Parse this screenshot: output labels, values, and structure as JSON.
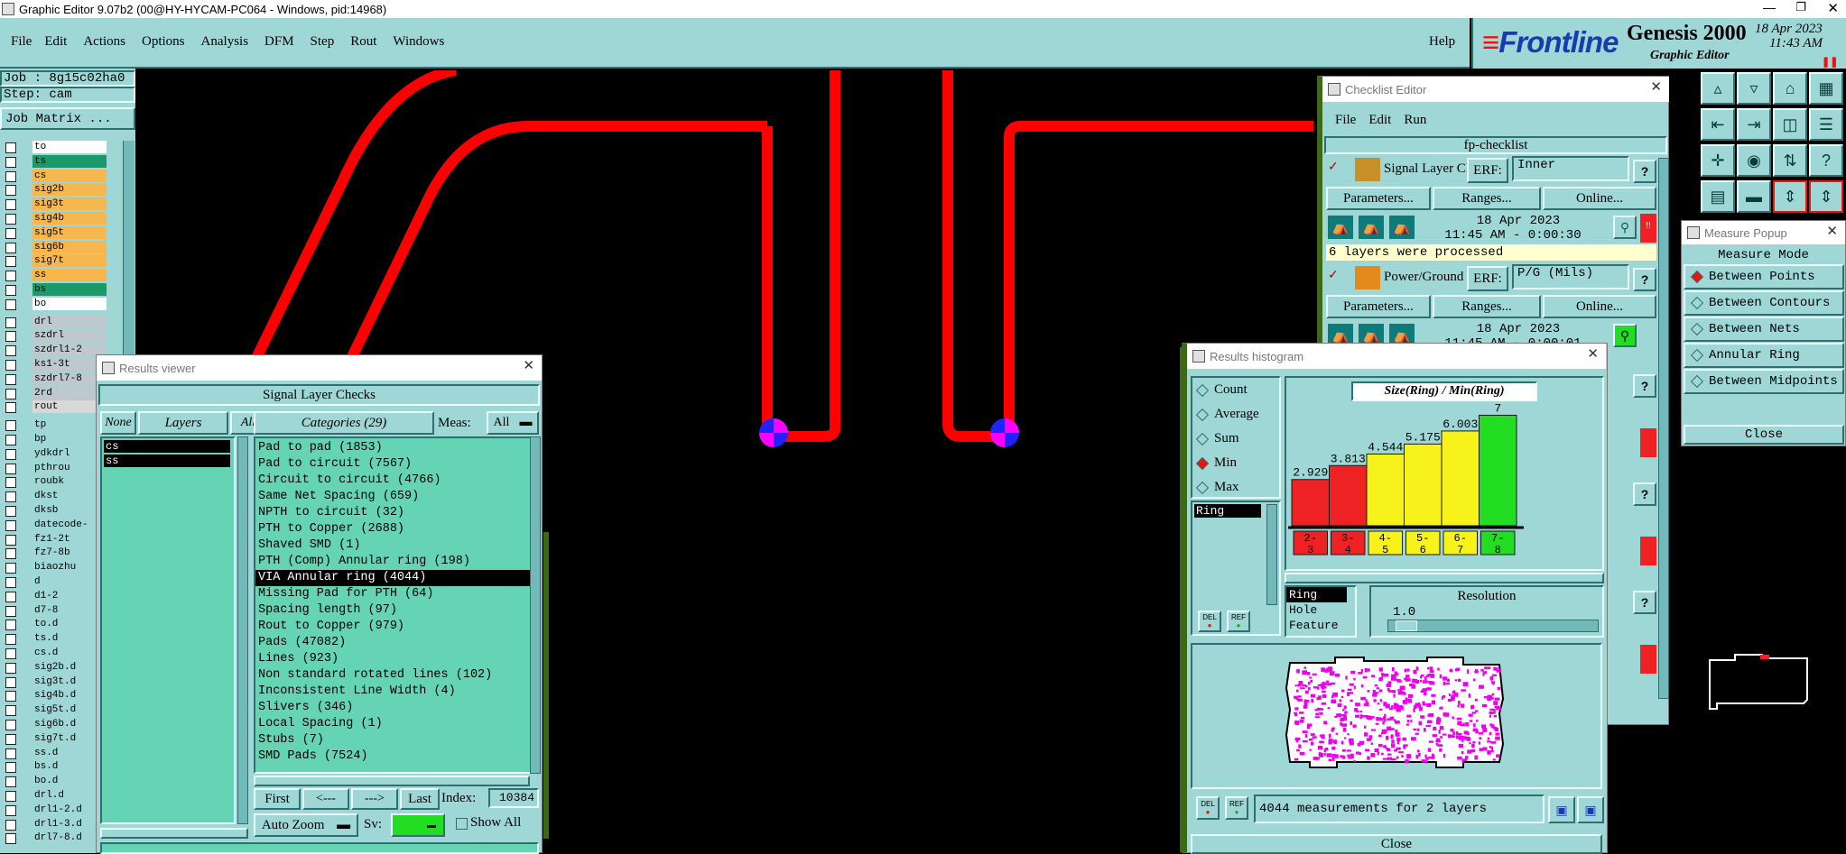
{
  "window": {
    "title": "Graphic Editor 9.07b2 (00@HY-HYCAM-PC064 - Windows, pid:14968)"
  },
  "menubar": {
    "items": [
      "File",
      "Edit",
      "Actions",
      "Options",
      "Analysis",
      "DFM",
      "Step",
      "Rout",
      "Windows"
    ],
    "help": "Help"
  },
  "brand": {
    "logo": "Frontline",
    "product": "Genesis 2000",
    "sub": "Graphic Editor",
    "date": "18 Apr 2023",
    "time": "11:43 AM"
  },
  "job": {
    "job_line": "Job : 8g15c02ha0",
    "step_line": "Step: cam",
    "matrix_button": "Job Matrix ..."
  },
  "layers": [
    {
      "name": "to",
      "color": "#ffffff"
    },
    {
      "name": "ts",
      "color": "#1a9a6a"
    },
    {
      "name": "cs",
      "color": "#f5b74e"
    },
    {
      "name": "sig2b",
      "color": "#f5b74e"
    },
    {
      "name": "sig3t",
      "color": "#f5b74e"
    },
    {
      "name": "sig4b",
      "color": "#f5b74e"
    },
    {
      "name": "sig5t",
      "color": "#f5b74e"
    },
    {
      "name": "sig6b",
      "color": "#f5b74e"
    },
    {
      "name": "sig7t",
      "color": "#f5b74e"
    },
    {
      "name": "ss",
      "color": "#f5b74e"
    },
    {
      "name": "bs",
      "color": "#1a9a6a"
    },
    {
      "name": "bo",
      "color": "#ffffff"
    },
    {
      "name": "drl",
      "color": "#bfc7cf"
    },
    {
      "name": "szdrl",
      "color": "#bfc7cf"
    },
    {
      "name": "szdrl1-2",
      "color": "#bfc7cf"
    },
    {
      "name": "ks1-3t",
      "color": "#bfc7cf"
    },
    {
      "name": "szdrl7-8",
      "color": "#bfc7cf"
    },
    {
      "name": "2rd",
      "color": "#bfc7cf"
    },
    {
      "name": "rout",
      "color": "#d8d8d8"
    },
    {
      "name": "tp",
      "color": "#9fd7d7"
    },
    {
      "name": "bp",
      "color": "#9fd7d7"
    },
    {
      "name": "ydkdrl",
      "color": "#9fd7d7"
    },
    {
      "name": "pthrou",
      "color": "#9fd7d7"
    },
    {
      "name": "roubk",
      "color": "#9fd7d7"
    },
    {
      "name": "dkst",
      "color": "#9fd7d7"
    },
    {
      "name": "dksb",
      "color": "#9fd7d7"
    },
    {
      "name": "datecode-",
      "color": "#9fd7d7"
    },
    {
      "name": "fz1-2t",
      "color": "#9fd7d7"
    },
    {
      "name": "fz7-8b",
      "color": "#9fd7d7"
    },
    {
      "name": "biaozhu",
      "color": "#9fd7d7"
    },
    {
      "name": "d",
      "color": "#9fd7d7"
    },
    {
      "name": "d1-2",
      "color": "#9fd7d7"
    },
    {
      "name": "d7-8",
      "color": "#9fd7d7"
    },
    {
      "name": "to.d",
      "color": "#9fd7d7"
    },
    {
      "name": "ts.d",
      "color": "#9fd7d7"
    },
    {
      "name": "cs.d",
      "color": "#9fd7d7"
    },
    {
      "name": "sig2b.d",
      "color": "#9fd7d7"
    },
    {
      "name": "sig3t.d",
      "color": "#9fd7d7"
    },
    {
      "name": "sig4b.d",
      "color": "#9fd7d7"
    },
    {
      "name": "sig5t.d",
      "color": "#9fd7d7"
    },
    {
      "name": "sig6b.d",
      "color": "#9fd7d7"
    },
    {
      "name": "sig7t.d",
      "color": "#9fd7d7"
    },
    {
      "name": "ss.d",
      "color": "#9fd7d7"
    },
    {
      "name": "bs.d",
      "color": "#9fd7d7"
    },
    {
      "name": "bo.d",
      "color": "#9fd7d7"
    },
    {
      "name": "drl.d",
      "color": "#9fd7d7"
    },
    {
      "name": "drl1-2.d",
      "color": "#9fd7d7"
    },
    {
      "name": "drl1-3.d",
      "color": "#9fd7d7"
    },
    {
      "name": "drl7-8.d",
      "color": "#9fd7d7"
    }
  ],
  "results_viewer": {
    "title": "Results viewer",
    "header": "Signal Layer Checks",
    "none_btn": "None",
    "layers_btn": "Layers",
    "all_btn": "All",
    "layer_list": [
      "cs",
      "ss"
    ],
    "categories_label": "Categories (29)",
    "meas_label": "Meas:",
    "meas_value": "All",
    "categories": [
      "Pad to pad (1853)",
      "Pad to circuit (7567)",
      "Circuit to circuit (4766)",
      "Same Net Spacing (659)",
      "NPTH to circuit (32)",
      "PTH to Copper (2688)",
      "Shaved SMD (1)",
      "PTH (Comp) Annular ring (198)",
      "VIA Annular ring (4044)",
      "Missing Pad for PTH (64)",
      "Spacing length (97)",
      "Rout to Copper (979)",
      "Pads (47082)",
      "Lines (923)",
      "Non standard rotated lines (102)",
      "Inconsistent Line Width (4)",
      "Slivers (346)",
      "Local Spacing (1)",
      "Stubs (7)",
      "SMD Pads (7524)"
    ],
    "selected_index": 8,
    "nav": {
      "first": "First",
      "prev": "<---",
      "next": "--->",
      "last": "Last",
      "index_label": "Index:",
      "index_value": "10384"
    },
    "auto_zoom": "Auto Zoom",
    "sv_label": "Sv:",
    "show_all": "Show All"
  },
  "checklist": {
    "title": "Checklist Editor",
    "menu": [
      "File",
      "Edit",
      "Run"
    ],
    "name": "fp-checklist",
    "checks": [
      {
        "name": "Signal Layer Ch",
        "erf": "ERF:",
        "erf_value": "Inner",
        "parameters": "Parameters...",
        "ranges": "Ranges...",
        "online": "Online...",
        "date": "18 Apr 2023",
        "time": "11:45 AM - 0:00:30",
        "status": "6 layers were processed"
      },
      {
        "name": "Power/Ground C",
        "erf": "ERF:",
        "erf_value": "P/G (Mils)",
        "parameters": "Parameters...",
        "ranges": "Ranges...",
        "online": "Online...",
        "date": "18 Apr 2023",
        "time": "11:45 AM - 0:00:01"
      }
    ]
  },
  "histogram": {
    "title": "Results histogram",
    "modes": [
      "Count",
      "Average",
      "Sum",
      "Min",
      "Max"
    ],
    "selected_mode": "Min",
    "ring_field": "Ring",
    "chart_title": "Size(Ring) / Min(Ring)",
    "resolution_label": "Resolution",
    "resolution_value": "1.0",
    "type_list": [
      "Ring",
      "Hole",
      "Feature"
    ],
    "status": "4044 measurements for 2 layers",
    "close": "Close",
    "del_label": "DEL",
    "ref_label": "REF"
  },
  "chart_data": {
    "type": "bar",
    "title": "Size(Ring) / Min(Ring)",
    "categories": [
      "2-3",
      "3-4",
      "4-5",
      "5-6",
      "6-7",
      "7-8"
    ],
    "values": [
      2.929,
      3.813,
      4.544,
      5.175,
      6.003,
      7
    ],
    "value_labels": [
      "2.929",
      "3.813",
      "4.544",
      "5.175",
      "6.003",
      "7"
    ],
    "bin_top": [
      "2-",
      "3-",
      "4-",
      "5-",
      "6-",
      "7-"
    ],
    "bin_bottom": [
      "3",
      "4",
      "5",
      "6",
      "7",
      "8"
    ],
    "colors": [
      "#ee2222",
      "#ee2222",
      "#f7f31a",
      "#f7f31a",
      "#f7f31a",
      "#22dd22"
    ],
    "ylim": [
      0,
      7.5
    ]
  },
  "measure": {
    "title": "Measure Popup",
    "header": "Measure Mode",
    "modes": [
      "Between Points",
      "Between Contours",
      "Between Nets",
      "Annular Ring",
      "Between Midpoints"
    ],
    "selected": "Between Points",
    "close": "Close"
  },
  "colors": {
    "accent_teal": "#9fd7d7",
    "list_green": "#64d4b4",
    "trace_red": "#ff0000",
    "via_magenta": "#ff00ff",
    "via_blue": "#2222ff"
  }
}
